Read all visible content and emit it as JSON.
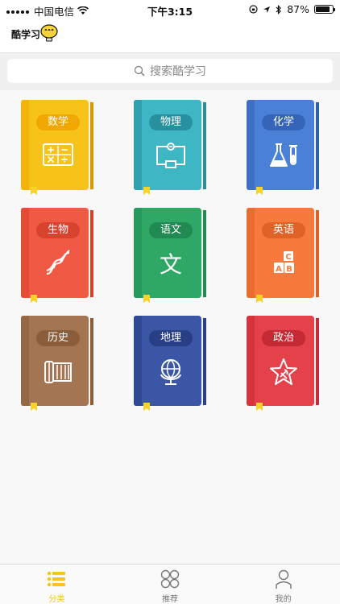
{
  "status": {
    "carrier": "中国电信",
    "time": "下午3:15",
    "battery": "87%",
    "battery_level": 0.87
  },
  "app": {
    "logo_text": "酷学习"
  },
  "search": {
    "placeholder": "搜索酷学习"
  },
  "subjects": [
    {
      "label": "数学",
      "icon": "calculator-icon",
      "cover": "#f7c318",
      "pill": "#f0a800",
      "edge": "#d99a00"
    },
    {
      "label": "物理",
      "icon": "circuit-icon",
      "cover": "#3fb6c4",
      "pill": "#26909e",
      "edge": "#2a8f9b"
    },
    {
      "label": "化学",
      "icon": "flask-icon",
      "cover": "#4a80d6",
      "pill": "#3465b8",
      "edge": "#2f5fae"
    },
    {
      "label": "生物",
      "icon": "dna-icon",
      "cover": "#f05a45",
      "pill": "#d8432e",
      "edge": "#cf4431"
    },
    {
      "label": "语文",
      "icon": "wen-character-icon",
      "cover": "#2fa866",
      "pill": "#208a52",
      "edge": "#228a51"
    },
    {
      "label": "英语",
      "icon": "abc-blocks-icon",
      "cover": "#f57a3c",
      "pill": "#df6227",
      "edge": "#d96027"
    },
    {
      "label": "历史",
      "icon": "scroll-icon",
      "cover": "#a37552",
      "pill": "#8a5d3b",
      "edge": "#8a5d3b"
    },
    {
      "label": "地理",
      "icon": "globe-icon",
      "cover": "#3a56a5",
      "pill": "#283f85",
      "edge": "#2a418a"
    },
    {
      "label": "政治",
      "icon": "star-emblem-icon",
      "cover": "#e4414a",
      "pill": "#c42a33",
      "edge": "#c12e37"
    }
  ],
  "tabs": [
    {
      "label": "分类",
      "icon": "list-icon",
      "active": true
    },
    {
      "label": "推荐",
      "icon": "grid-circles-icon",
      "active": false
    },
    {
      "label": "我的",
      "icon": "person-icon",
      "active": false
    }
  ]
}
